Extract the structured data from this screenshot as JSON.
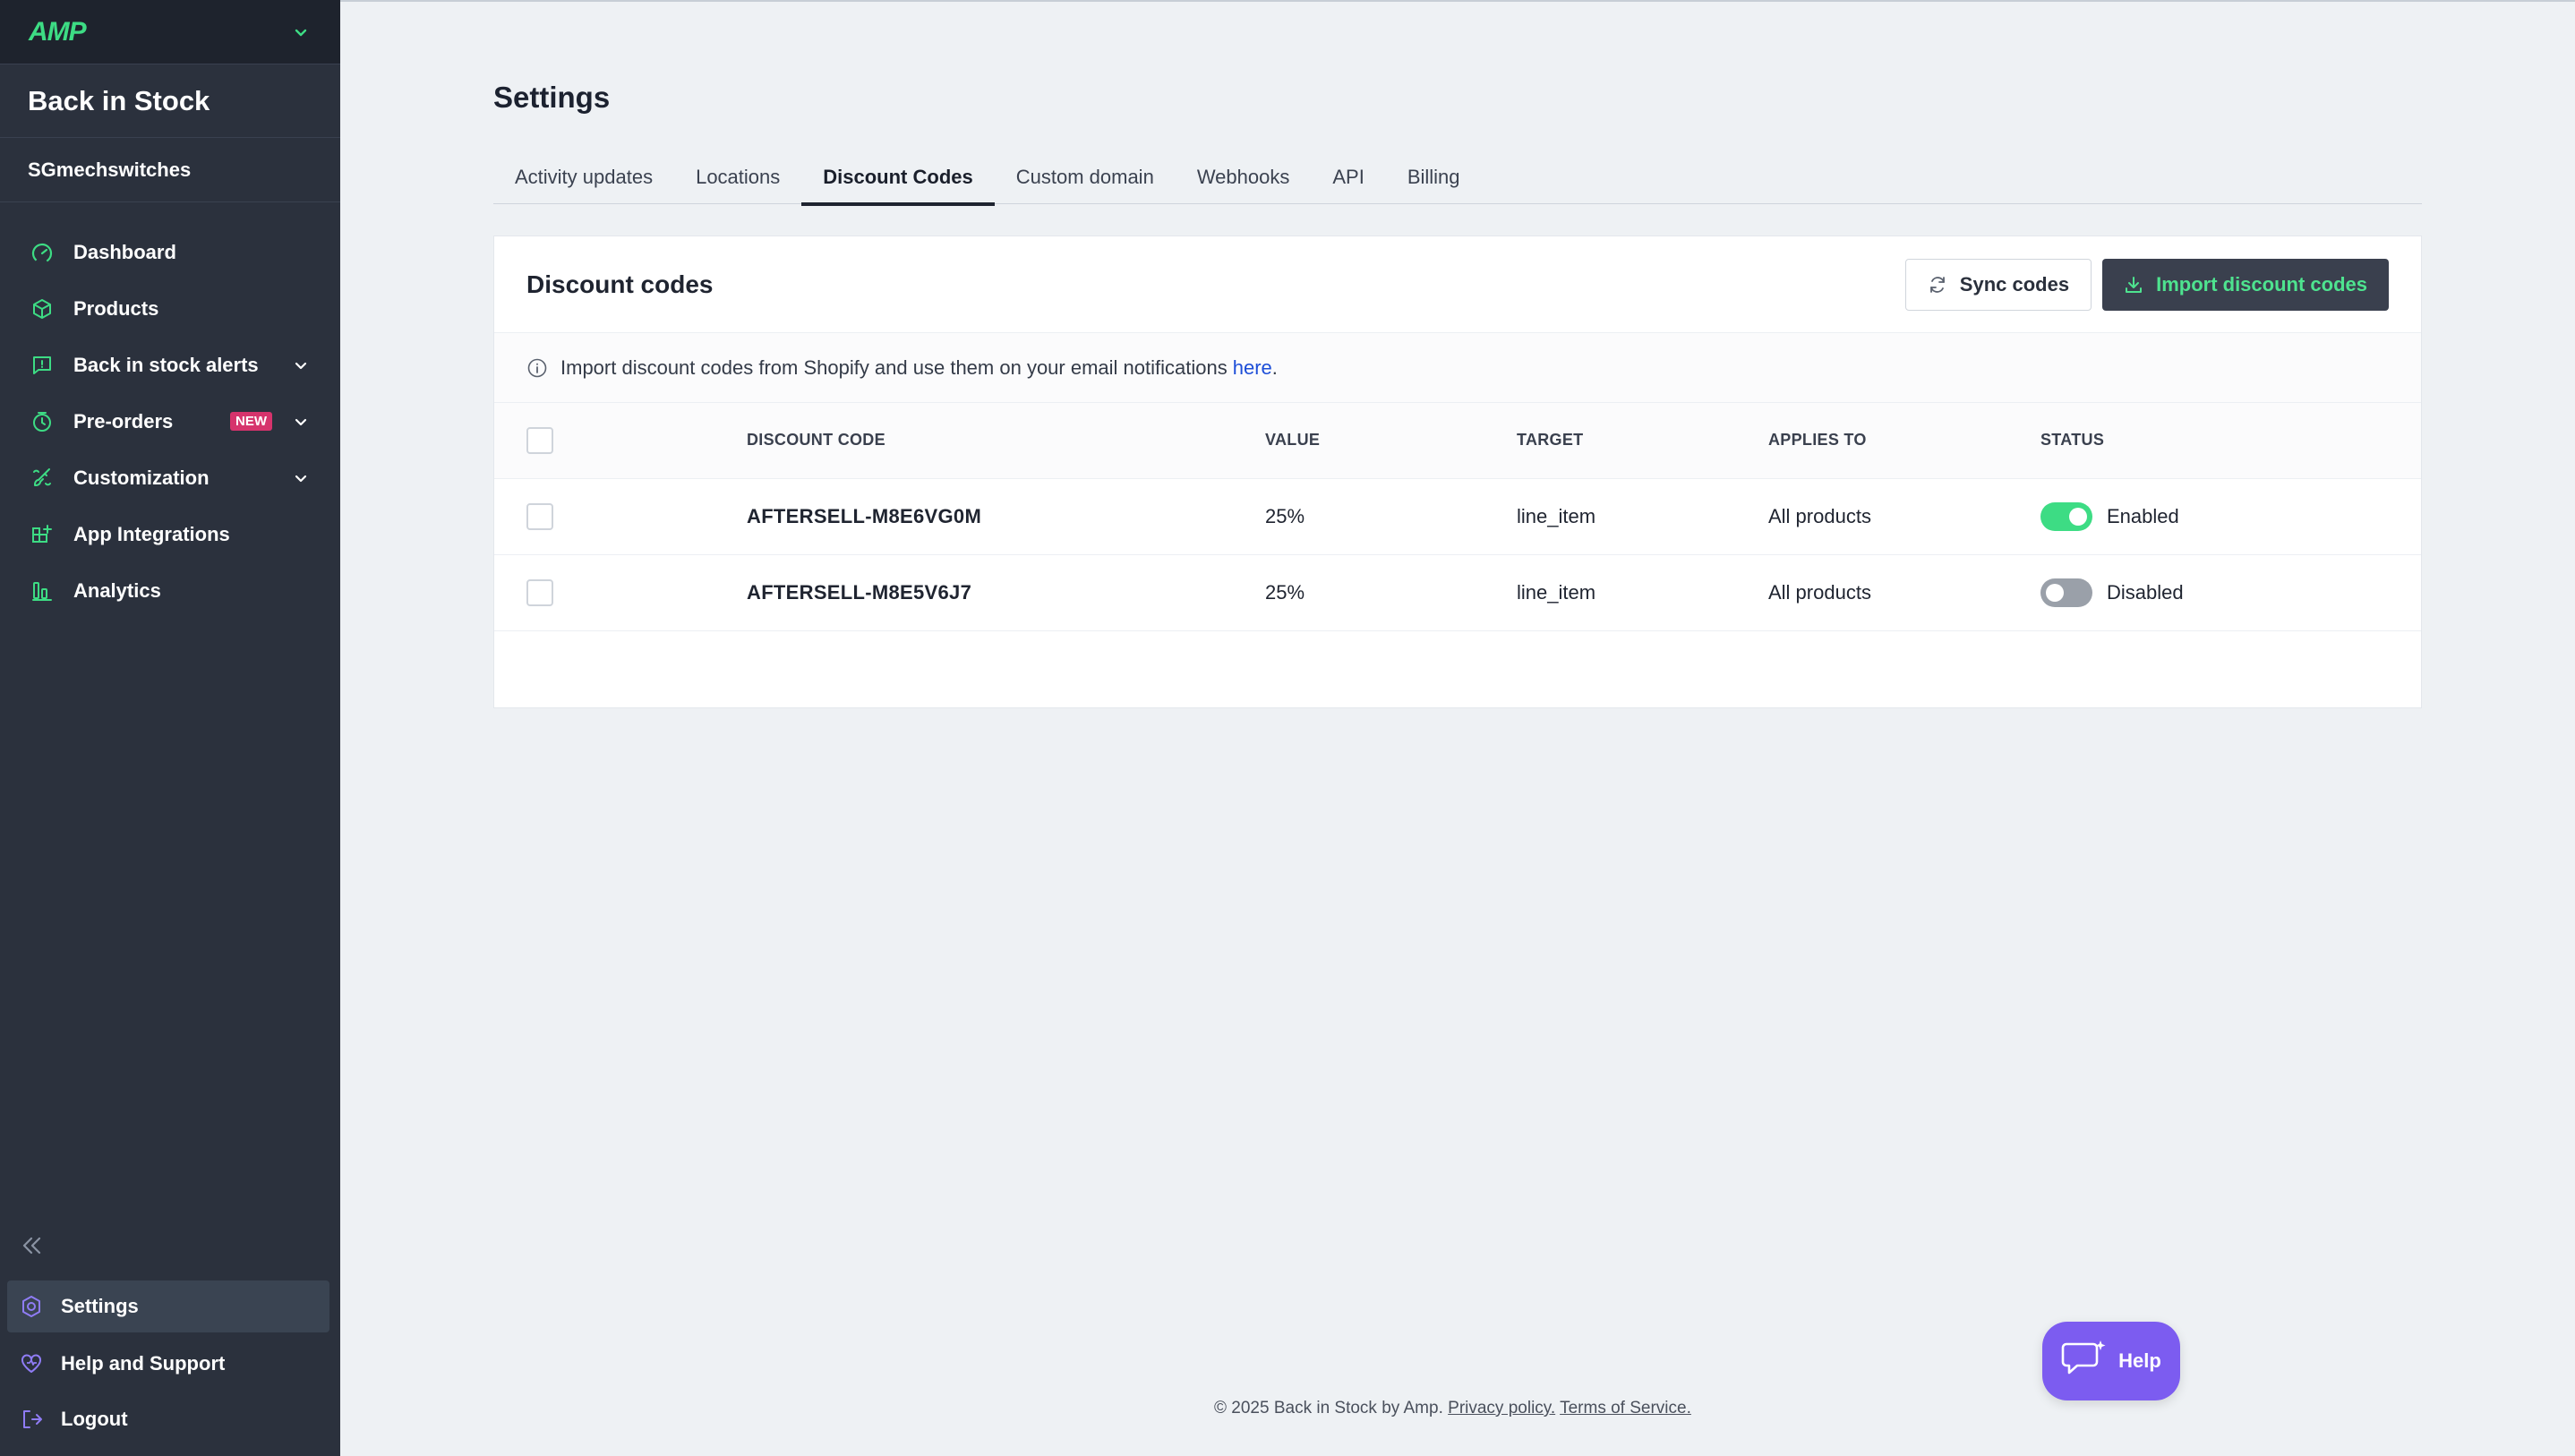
{
  "sidebar": {
    "logo": "AMP",
    "app_title": "Back in Stock",
    "store_name": "SGmechswitches",
    "items": [
      {
        "label": "Dashboard",
        "icon": "gauge-icon"
      },
      {
        "label": "Products",
        "icon": "box-icon"
      },
      {
        "label": "Back in stock alerts",
        "icon": "message-icon",
        "has_chevron": true
      },
      {
        "label": "Pre-orders",
        "icon": "clock-icon",
        "badge": "NEW",
        "has_chevron": true
      },
      {
        "label": "Customization",
        "icon": "brush-icon",
        "has_chevron": true
      },
      {
        "label": "App Integrations",
        "icon": "grid-plus-icon"
      },
      {
        "label": "Analytics",
        "icon": "chart-icon"
      }
    ],
    "bottom_items": [
      {
        "label": "Settings",
        "icon": "settings-icon",
        "active": true
      },
      {
        "label": "Help and Support",
        "icon": "heart-icon"
      },
      {
        "label": "Logout",
        "icon": "logout-icon"
      }
    ]
  },
  "page": {
    "title": "Settings",
    "tabs": [
      {
        "label": "Activity updates"
      },
      {
        "label": "Locations"
      },
      {
        "label": "Discount Codes",
        "active": true
      },
      {
        "label": "Custom domain"
      },
      {
        "label": "Webhooks"
      },
      {
        "label": "API"
      },
      {
        "label": "Billing"
      }
    ]
  },
  "card": {
    "title": "Discount codes",
    "sync_label": "Sync codes",
    "import_label": "Import discount codes",
    "info_text": "Import discount codes from Shopify and use them on your email notifications",
    "info_link": "here",
    "info_suffix": ".",
    "columns": [
      "DISCOUNT CODE",
      "VALUE",
      "TARGET",
      "APPLIES TO",
      "STATUS"
    ],
    "rows": [
      {
        "code": "AFTERSELL-M8E6VG0M",
        "value": "25%",
        "target": "line_item",
        "applies_to": "All products",
        "status": "Enabled",
        "enabled": true
      },
      {
        "code": "AFTERSELL-M8E5V6J7",
        "value": "25%",
        "target": "line_item",
        "applies_to": "All products",
        "status": "Disabled",
        "enabled": false
      }
    ]
  },
  "footer": {
    "text": "© 2025 Back in Stock by Amp.",
    "privacy": "Privacy policy.",
    "terms": "Terms of Service."
  },
  "help_button": {
    "label": "Help"
  },
  "colors": {
    "accent": "#3ddc84",
    "sidebar": "#2b313d",
    "help": "#7c5cf0",
    "badge": "#d6336c"
  }
}
